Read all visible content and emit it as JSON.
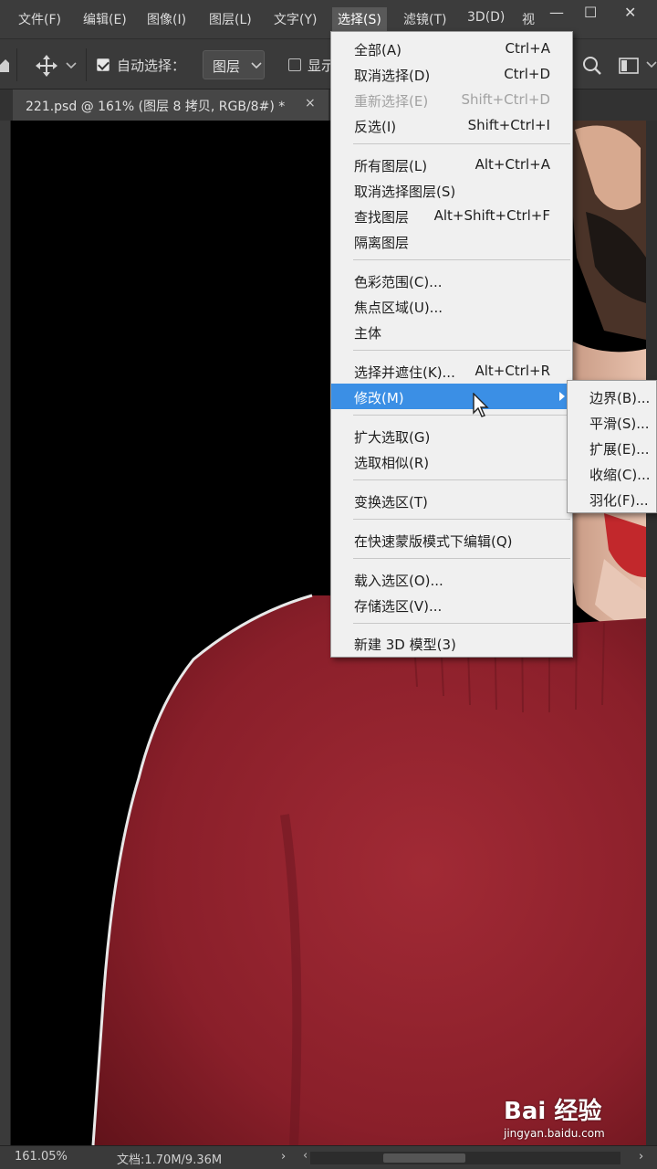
{
  "menubar": {
    "items": [
      "文件(F)",
      "编辑(E)",
      "图像(I)",
      "图层(L)",
      "文字(Y)",
      "选择(S)",
      "滤镜(T)",
      "3D(D)",
      "视"
    ],
    "active_index": 5
  },
  "window_controls": [
    "minimize-icon",
    "maximize-icon",
    "close-icon"
  ],
  "options_bar": {
    "auto_select_label": "自动选择：",
    "auto_select_checked": true,
    "target_value": "图层",
    "show_label": "显示"
  },
  "document_tab": {
    "title": "221.psd @ 161% (图层 8 拷贝, RGB/8#) *",
    "close_glyph": "×"
  },
  "select_menu": {
    "items": [
      {
        "label": "全部(A)",
        "shortcut": "Ctrl+A"
      },
      {
        "label": "取消选择(D)",
        "shortcut": "Ctrl+D"
      },
      {
        "label": "重新选择(E)",
        "shortcut": "Shift+Ctrl+D",
        "disabled": true
      },
      {
        "label": "反选(I)",
        "shortcut": "Shift+Ctrl+I"
      },
      {
        "label": "所有图层(L)",
        "shortcut": "Alt+Ctrl+A"
      },
      {
        "label": "取消选择图层(S)",
        "shortcut": ""
      },
      {
        "label": "查找图层",
        "shortcut": "Alt+Shift+Ctrl+F"
      },
      {
        "label": "隔离图层",
        "shortcut": ""
      },
      {
        "label": "色彩范围(C)...",
        "shortcut": ""
      },
      {
        "label": "焦点区域(U)...",
        "shortcut": ""
      },
      {
        "label": "主体",
        "shortcut": ""
      },
      {
        "label": "选择并遮住(K)...",
        "shortcut": "Alt+Ctrl+R"
      },
      {
        "label": "修改(M)",
        "shortcut": "",
        "highlight": true,
        "submenu": true
      },
      {
        "label": "扩大选取(G)",
        "shortcut": ""
      },
      {
        "label": "选取相似(R)",
        "shortcut": ""
      },
      {
        "label": "变换选区(T)",
        "shortcut": ""
      },
      {
        "label": "在快速蒙版模式下编辑(Q)",
        "shortcut": ""
      },
      {
        "label": "载入选区(O)...",
        "shortcut": ""
      },
      {
        "label": "存储选区(V)...",
        "shortcut": ""
      },
      {
        "label": "新建 3D 模型(3)",
        "shortcut": ""
      }
    ]
  },
  "modify_submenu": {
    "items": [
      "边界(B)...",
      "平滑(S)...",
      "扩展(E)...",
      "收缩(C)...",
      "羽化(F)..."
    ]
  },
  "status_bar": {
    "zoom": "161.05%",
    "doc_info": "文档:1.70M/9.36M",
    "arrow": "›",
    "left_arrow": "‹",
    "right_arrow": "›"
  },
  "watermark": {
    "main": "Bai 经验",
    "sub": "jingyan.baidu.com"
  },
  "colors": {
    "menu_highlight": "#3b8fe5",
    "sweater": "#8e1f2a",
    "canvas": "#000000"
  }
}
